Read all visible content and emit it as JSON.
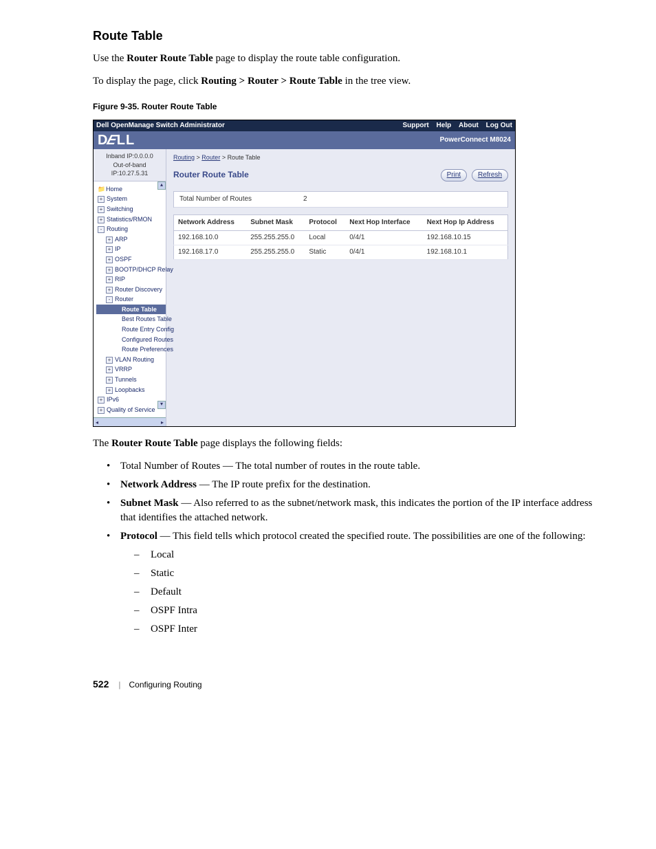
{
  "doc": {
    "heading": "Route Table",
    "intro_pre": "Use the ",
    "intro_bold": "Router Route Table",
    "intro_post": " page to display the route table configuration.",
    "nav_pre": "To display the page, click ",
    "nav_bold": "Routing > Router > Route Table",
    "nav_post": " in the tree view.",
    "fig_caption": "Figure 9-35.    Router Route Table",
    "desc_pre": "The ",
    "desc_bold": "Router Route Table",
    "desc_post": " page displays the following fields:",
    "fields": {
      "total": "Total Number of Routes — The total number of routes in the route table.",
      "net_b": "Network Address",
      "net_t": " — The IP route prefix for the destination.",
      "mask_b": "Subnet Mask",
      "mask_t": " — Also referred to as the subnet/network mask, this indicates the portion of the IP interface address that identifies the attached network.",
      "proto_b": "Protocol",
      "proto_t": " — This field tells which protocol created the specified route. The possibilities are one of the following:"
    },
    "protocols": [
      "Local",
      "Static",
      "Default",
      "OSPF Intra",
      "OSPF Inter"
    ],
    "page_number": "522",
    "footer_section": "Configuring Routing"
  },
  "shot": {
    "title": "Dell OpenManage Switch Administrator",
    "top_links": [
      "Support",
      "Help",
      "About",
      "Log Out"
    ],
    "brand": "DELL",
    "model": "PowerConnect M8024",
    "ip1": "Inband IP:0.0.0.0",
    "ip2": "Out-of-band IP:10.27.5.31",
    "tree": [
      {
        "lvl": 1,
        "exp": "",
        "icon": "folder",
        "label": "Home"
      },
      {
        "lvl": 1,
        "exp": "+",
        "label": "System"
      },
      {
        "lvl": 1,
        "exp": "+",
        "label": "Switching"
      },
      {
        "lvl": 1,
        "exp": "+",
        "label": "Statistics/RMON"
      },
      {
        "lvl": 1,
        "exp": "-",
        "label": "Routing"
      },
      {
        "lvl": 2,
        "exp": "+",
        "label": "ARP"
      },
      {
        "lvl": 2,
        "exp": "+",
        "label": "IP"
      },
      {
        "lvl": 2,
        "exp": "+",
        "label": "OSPF"
      },
      {
        "lvl": 2,
        "exp": "+",
        "label": "BOOTP/DHCP Relay"
      },
      {
        "lvl": 2,
        "exp": "+",
        "label": "RIP"
      },
      {
        "lvl": 2,
        "exp": "+",
        "label": "Router Discovery"
      },
      {
        "lvl": 2,
        "exp": "-",
        "label": "Router"
      },
      {
        "lvl": 3,
        "exp": "",
        "label": "Route Table",
        "active": true
      },
      {
        "lvl": 3,
        "exp": "",
        "label": "Best Routes Table"
      },
      {
        "lvl": 3,
        "exp": "",
        "label": "Route Entry Config"
      },
      {
        "lvl": 3,
        "exp": "",
        "label": "Configured Routes"
      },
      {
        "lvl": 3,
        "exp": "",
        "label": "Route Preferences"
      },
      {
        "lvl": 2,
        "exp": "+",
        "label": "VLAN Routing"
      },
      {
        "lvl": 2,
        "exp": "+",
        "label": "VRRP"
      },
      {
        "lvl": 2,
        "exp": "+",
        "label": "Tunnels"
      },
      {
        "lvl": 2,
        "exp": "+",
        "label": "Loopbacks"
      },
      {
        "lvl": 1,
        "exp": "+",
        "label": "IPv6"
      },
      {
        "lvl": 1,
        "exp": "+",
        "label": "Quality of Service"
      }
    ],
    "crumbs": {
      "a": "Routing",
      "b": "Router",
      "c": "Route Table"
    },
    "page_title": "Router Route Table",
    "btn_print": "Print",
    "btn_refresh": "Refresh",
    "total_label": "Total Number of Routes",
    "total_value": "2",
    "cols": [
      "Network Address",
      "Subnet Mask",
      "Protocol",
      "Next Hop Interface",
      "Next Hop Ip Address"
    ],
    "rows": [
      {
        "c0": "192.168.10.0",
        "c1": "255.255.255.0",
        "c2": "Local",
        "c3": "0/4/1",
        "c4": "192.168.10.15"
      },
      {
        "c0": "192.168.17.0",
        "c1": "255.255.255.0",
        "c2": "Static",
        "c3": "0/4/1",
        "c4": "192.168.10.1"
      }
    ]
  }
}
